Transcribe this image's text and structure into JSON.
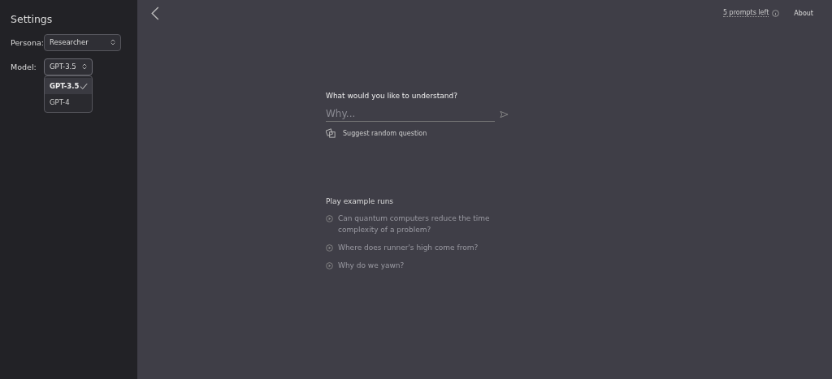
{
  "sidebar": {
    "title": "Settings",
    "persona": {
      "label": "Persona:",
      "value": "Researcher"
    },
    "model": {
      "label": "Model:",
      "value": "GPT-3.5",
      "expanded": true,
      "options": [
        {
          "label": "GPT-3.5",
          "selected": true
        },
        {
          "label": "GPT-4",
          "selected": false
        }
      ]
    }
  },
  "header": {
    "prompts_left": "5 prompts left",
    "about": "About"
  },
  "question": {
    "label": "What would you like to understand?",
    "placeholder": "Why...",
    "suggest": "Suggest random question"
  },
  "examples": {
    "title": "Play example runs",
    "items": [
      "Can quantum computers reduce the time complexity of a problem?",
      "Where does runner's high come from?",
      "Why do we yawn?"
    ]
  }
}
